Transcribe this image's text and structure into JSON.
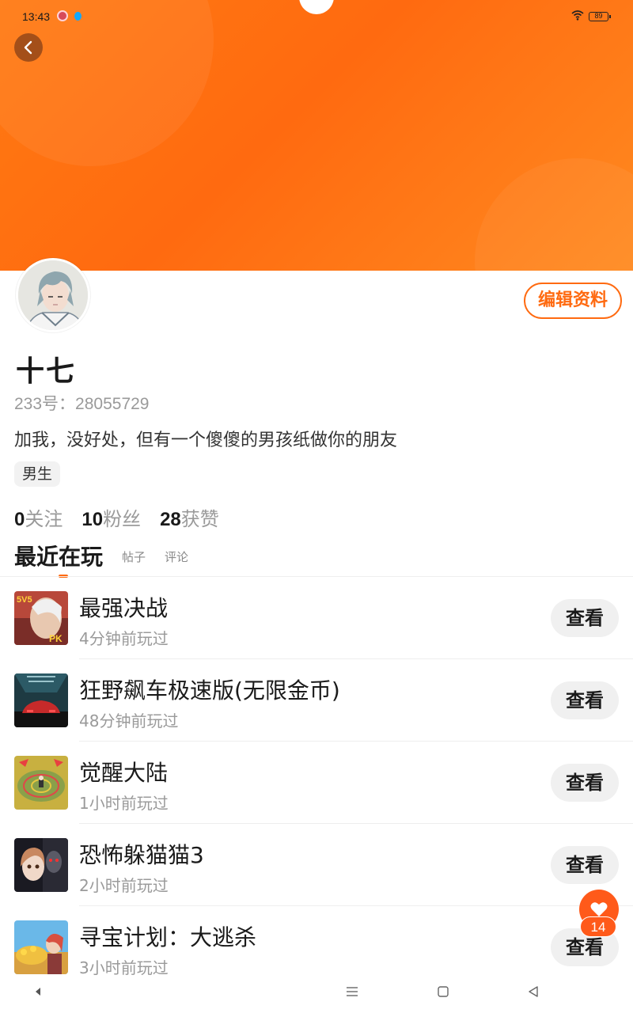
{
  "status_bar": {
    "time": "13:43",
    "battery": "89"
  },
  "profile": {
    "name": "十七",
    "id_label": "233号：",
    "id_value": "28055729",
    "bio": "加我，没好处，但有一个傻傻的男孩纸做你的朋友",
    "gender": "男生",
    "edit_button": "编辑资料"
  },
  "stats": [
    {
      "num": "0",
      "label": "关注"
    },
    {
      "num": "10",
      "label": "粉丝"
    },
    {
      "num": "28",
      "label": "获赞"
    }
  ],
  "tabs": {
    "active": "最近在玩",
    "items": [
      "帖子",
      "评论"
    ]
  },
  "games": [
    {
      "title": "最强决战",
      "time": "4分钟前玩过",
      "button": "查看",
      "thumb_badge": "5V5",
      "thumb_badge2": "PK"
    },
    {
      "title": "狂野飙车极速版(无限金币)",
      "time": "48分钟前玩过",
      "button": "查看"
    },
    {
      "title": "觉醒大陆",
      "time": "1小时前玩过",
      "button": "查看"
    },
    {
      "title": "恐怖躲猫猫3",
      "time": "2小时前玩过",
      "button": "查看"
    },
    {
      "title": "寻宝计划：大逃杀",
      "time": "3小时前玩过",
      "button": "查看"
    }
  ],
  "like_count": "14",
  "colors": {
    "accent": "#ff6a10",
    "banner": "#ff7a12"
  },
  "icons": [
    "back-arrow-icon",
    "wifi-icon",
    "battery-icon",
    "heart-icon",
    "nav-back-icon",
    "nav-menu-icon",
    "nav-home-icon",
    "nav-recent-icon"
  ]
}
